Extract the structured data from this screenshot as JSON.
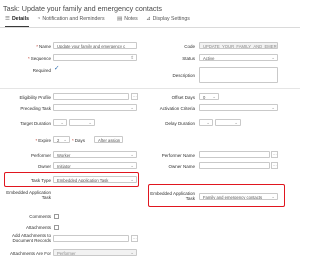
{
  "title": "Task: Update your family and emergency contacts",
  "tabs": [
    {
      "label": "Details",
      "icon": "details-icon",
      "active": true
    },
    {
      "label": "Notification and Reminders",
      "icon": "bell-icon"
    },
    {
      "label": "Notes",
      "icon": "notes-icon"
    },
    {
      "label": "Display Settings",
      "icon": "display-icon"
    }
  ],
  "form": {
    "name_label": "Name",
    "name_value": "Update your family and emergency c",
    "sequence_label": "Sequence",
    "required_label": "Required",
    "code_label": "Code",
    "code_value": "UPDATE_YOUR_FAMILY_AND_EMERG",
    "status_label": "Status",
    "status_value": "Active",
    "description_label": "Description",
    "eligibility_label": "Eligibility Profile",
    "preceding_label": "Preceding Task",
    "target_label": "Target Duration",
    "expire_label": "Expire",
    "expire_value": "2",
    "days_label": "Days",
    "after_assign_value": "After assign",
    "offset_label": "Offset Days",
    "offset_value": "0",
    "activation_label": "Activation Criteria",
    "delay_label": "Delay Duration",
    "performer_label": "Performer",
    "performer_value": "Worker",
    "owner_label": "Owner",
    "owner_value": "Initiator",
    "performer_name_label": "Performer Name",
    "owner_name_label": "Owner Name",
    "task_type_label": "Task Type",
    "task_type_value": "Embedded Application Task",
    "embedded_label_left": "Embedded Application Task",
    "embedded_label_right": "Embedded Application Task",
    "embedded_value_right": "Family and emergency contacts",
    "comments_label": "Comments",
    "attachments_label": "Attachments",
    "add_attach_label": "Add Attachments to Document Records",
    "attach_are_for_label": "Attachments Are For",
    "attach_are_for_value": "Performer"
  },
  "colors": {
    "highlight": "#e0161f",
    "accent": "#2b6cb0"
  }
}
